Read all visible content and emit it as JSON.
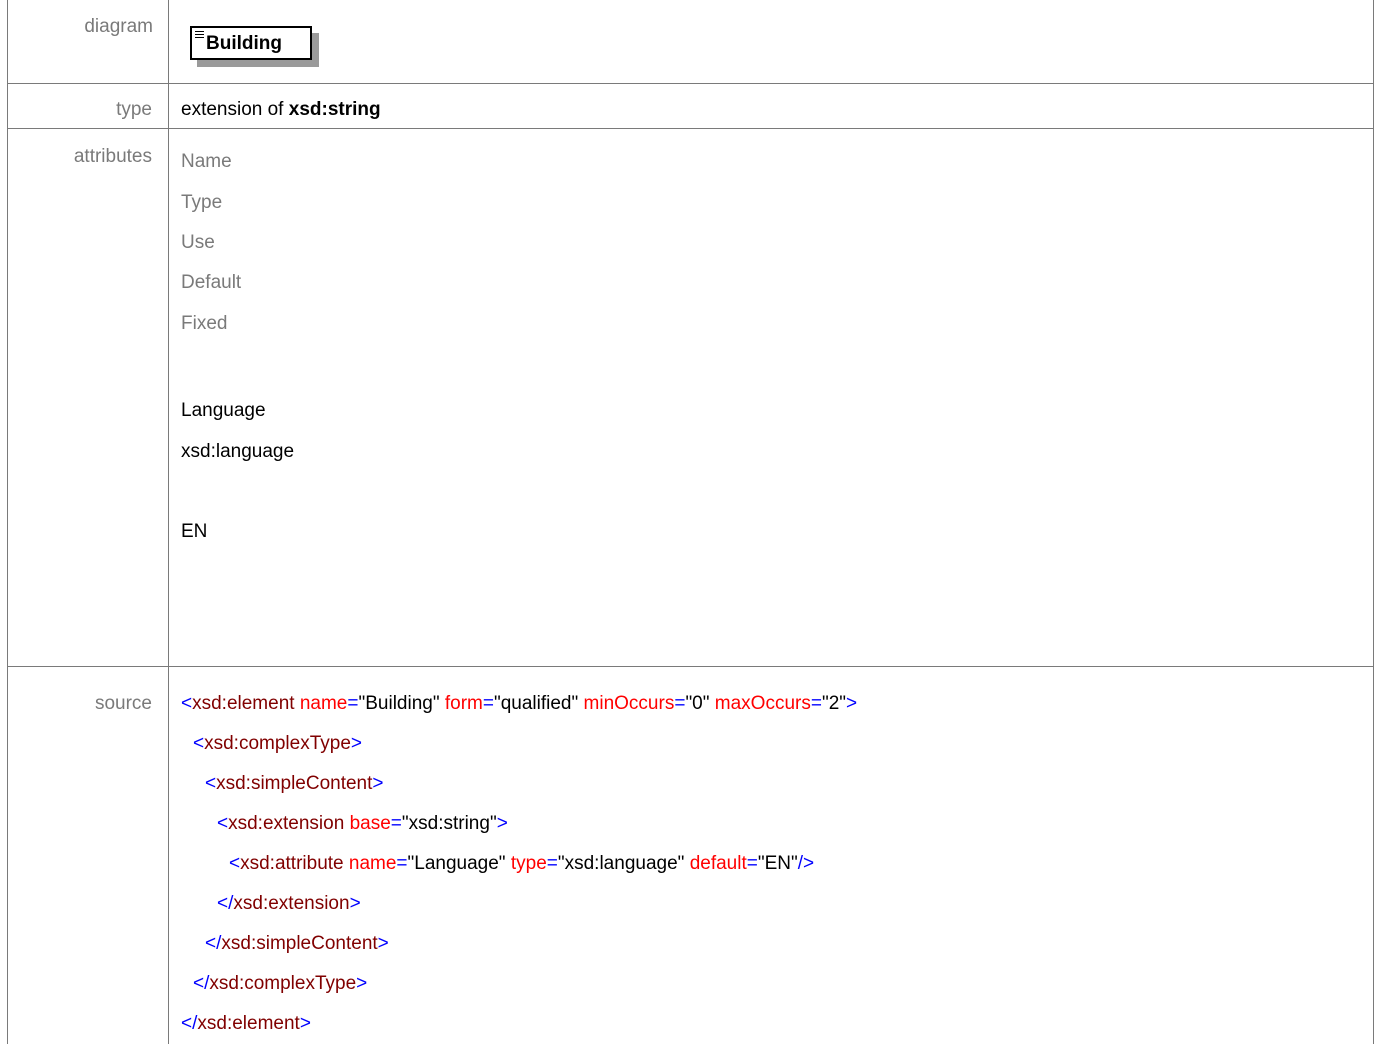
{
  "rows": {
    "diagram": {
      "label": "diagram",
      "element_name": "Building"
    },
    "type": {
      "label": "type",
      "prefix": "extension of ",
      "base": "xsd:string"
    },
    "attributes": {
      "label": "attributes",
      "headers": [
        "Name",
        "Type",
        "Use",
        "Default",
        "Fixed"
      ],
      "values": {
        "name": "Language",
        "type": "xsd:language",
        "use": "",
        "default": "EN",
        "fixed": ""
      }
    },
    "source": {
      "label": "source",
      "lines": [
        {
          "indent": 0,
          "open": "<",
          "tag": "xsd:element",
          "attrs": [
            {
              "name": "name",
              "value": "\"Building\""
            },
            {
              "name": "form",
              "value": "\"qualified\""
            },
            {
              "name": "minOccurs",
              "value": "\"0\""
            },
            {
              "name": "maxOccurs",
              "value": "\"2\""
            }
          ],
          "close": ">"
        },
        {
          "indent": 1,
          "open": "<",
          "tag": "xsd:complexType",
          "attrs": [],
          "close": ">"
        },
        {
          "indent": 2,
          "open": "<",
          "tag": "xsd:simpleContent",
          "attrs": [],
          "close": ">"
        },
        {
          "indent": 3,
          "open": "<",
          "tag": "xsd:extension",
          "attrs": [
            {
              "name": "base",
              "value": "\"xsd:string\""
            }
          ],
          "close": ">"
        },
        {
          "indent": 4,
          "open": "<",
          "tag": "xsd:attribute",
          "attrs": [
            {
              "name": "name",
              "value": "\"Language\""
            },
            {
              "name": "type",
              "value": "\"xsd:language\""
            },
            {
              "name": "default",
              "value": "\"EN\""
            }
          ],
          "close": "/>"
        },
        {
          "indent": 3,
          "open": "</",
          "tag": "xsd:extension",
          "attrs": [],
          "close": ">"
        },
        {
          "indent": 2,
          "open": "</",
          "tag": "xsd:simpleContent",
          "attrs": [],
          "close": ">"
        },
        {
          "indent": 1,
          "open": "</",
          "tag": "xsd:complexType",
          "attrs": [],
          "close": ">"
        },
        {
          "indent": 0,
          "open": "</",
          "tag": "xsd:element",
          "attrs": [],
          "close": ">"
        }
      ]
    }
  },
  "colors": {
    "border": "#7a7a7a",
    "bracket": "#0000ff",
    "element": "#800000",
    "attribute": "#ff0000",
    "label": "#7a7a7a"
  }
}
